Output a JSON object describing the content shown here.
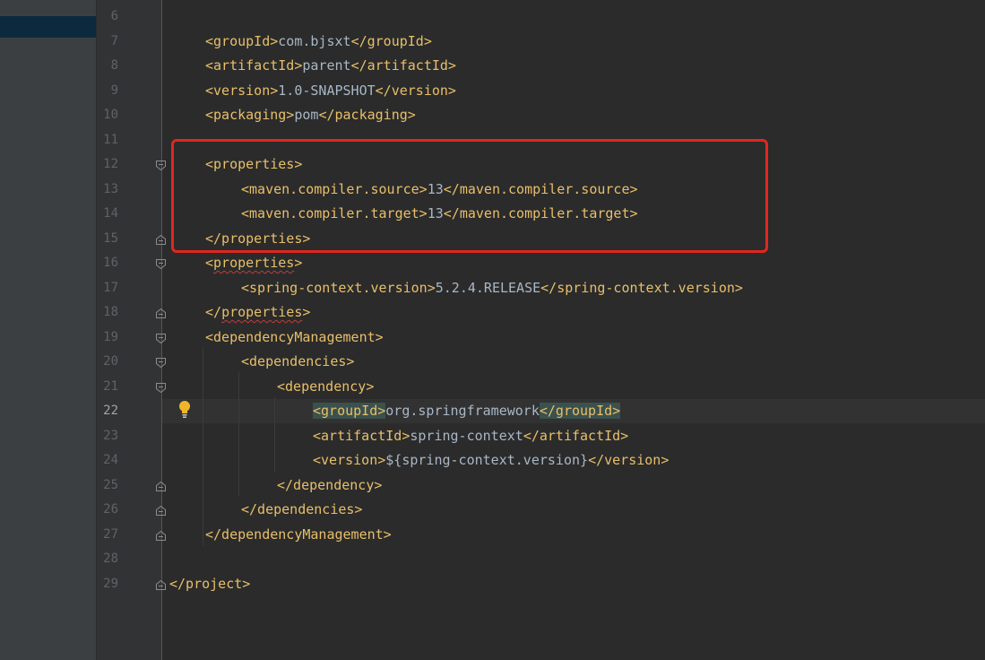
{
  "editor": {
    "current_line": 22,
    "lines": [
      {
        "num": "6",
        "code": "",
        "indent": 0
      },
      {
        "num": "7",
        "code": "<groupId>com.bjsxt</groupId>",
        "indent": 1
      },
      {
        "num": "8",
        "code": "<artifactId>parent</artifactId>",
        "indent": 1
      },
      {
        "num": "9",
        "code": "<version>1.0-SNAPSHOT</version>",
        "indent": 1
      },
      {
        "num": "10",
        "code": "<packaging>pom</packaging>",
        "indent": 1
      },
      {
        "num": "11",
        "code": "",
        "indent": 0
      },
      {
        "num": "12",
        "code": "<properties>",
        "indent": 1,
        "fold": "open"
      },
      {
        "num": "13",
        "code": "<maven.compiler.source>13</maven.compiler.source>",
        "indent": 2
      },
      {
        "num": "14",
        "code": "<maven.compiler.target>13</maven.compiler.target>",
        "indent": 2
      },
      {
        "num": "15",
        "code": "</properties>",
        "indent": 1,
        "fold": "close"
      },
      {
        "num": "16",
        "code": "<properties>",
        "indent": 1,
        "fold": "open",
        "squiggle": "properties"
      },
      {
        "num": "17",
        "code": "<spring-context.version>5.2.4.RELEASE</spring-context.version>",
        "indent": 2
      },
      {
        "num": "18",
        "code": "</properties>",
        "indent": 1,
        "fold": "close",
        "squiggle": "properties"
      },
      {
        "num": "19",
        "code": "<dependencyManagement>",
        "indent": 1,
        "fold": "open"
      },
      {
        "num": "20",
        "code": "<dependencies>",
        "indent": 2,
        "fold": "open"
      },
      {
        "num": "21",
        "code": "<dependency>",
        "indent": 3,
        "fold": "open"
      },
      {
        "num": "22",
        "code": "<groupId>org.springframework</groupId>",
        "indent": 4,
        "highlight": true
      },
      {
        "num": "23",
        "code": "<artifactId>spring-context</artifactId>",
        "indent": 4
      },
      {
        "num": "24",
        "code": "<version>${spring-context.version}</version>",
        "indent": 4
      },
      {
        "num": "25",
        "code": "</dependency>",
        "indent": 3,
        "fold": "close"
      },
      {
        "num": "26",
        "code": "</dependencies>",
        "indent": 2,
        "fold": "close"
      },
      {
        "num": "27",
        "code": "</dependencyManagement>",
        "indent": 1,
        "fold": "close"
      },
      {
        "num": "28",
        "code": "",
        "indent": 0
      },
      {
        "num": "29",
        "code": "</project>",
        "indent": 0,
        "fold": "close"
      }
    ]
  },
  "icons": {
    "intention": "lightbulb-icon",
    "fold_open": "fold-open-icon",
    "fold_close": "fold-close-icon"
  },
  "colors": {
    "background": "#2b2b2b",
    "gutter": "#313335",
    "tag": "#e8bf6a",
    "text": "#a9b7c6",
    "annotation_box": "#e0271f",
    "match_highlight": "#3b514d"
  }
}
